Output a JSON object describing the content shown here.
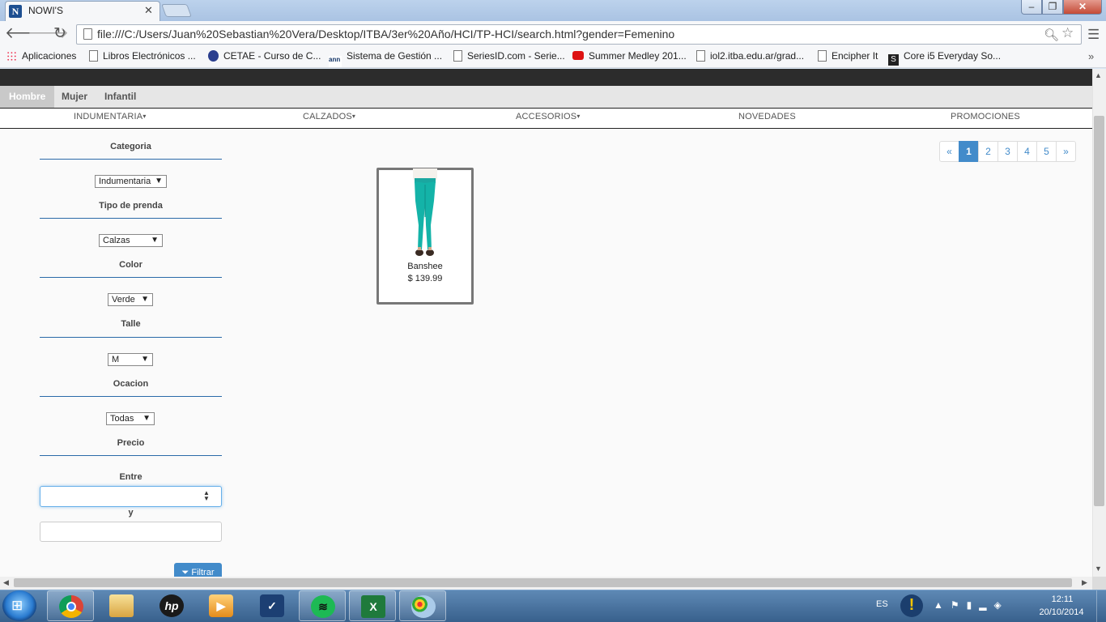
{
  "browser": {
    "tab_title": "NOWI'S",
    "favicon_letter": "N",
    "url": "file:///C:/Users/Juan%20Sebastian%20Vera/Desktop/ITBA/3er%20Año/HCI/TP-HCI/search.html?gender=Femenino",
    "window_buttons": {
      "minimize": "‒",
      "maximize": "❐",
      "close": "✕"
    },
    "bookmarks": [
      {
        "label": "Aplicaciones",
        "icon": "apps-icon"
      },
      {
        "label": "Libros Electrónicos ...",
        "icon": "page-icon"
      },
      {
        "label": "CETAE - Curso de C...",
        "icon": "cetae-icon"
      },
      {
        "label": "Sistema de Gestión ...",
        "icon": "sistema-icon"
      },
      {
        "label": "SeriesID.com - Serie...",
        "icon": "page-icon"
      },
      {
        "label": "Summer Medley 201...",
        "icon": "youtube-icon"
      },
      {
        "label": "iol2.itba.edu.ar/grad...",
        "icon": "page-icon"
      },
      {
        "label": "Encipher It",
        "icon": "page-icon"
      },
      {
        "label": "Core i5 Everyday So...",
        "icon": "site-s-icon"
      }
    ]
  },
  "site": {
    "gender_tabs": [
      "Hombre",
      "Mujer",
      "Infantil"
    ],
    "active_gender": "Hombre",
    "categories": [
      "INDUMENTARIA",
      "CALZADOS",
      "ACCESORIOS",
      "NOVEDADES",
      "PROMOCIONES"
    ],
    "filters": {
      "categoria": {
        "label": "Categoria",
        "value": "Indumentaria"
      },
      "tipo": {
        "label": "Tipo de prenda",
        "value": "Calzas"
      },
      "color": {
        "label": "Color",
        "value": "Verde"
      },
      "talle": {
        "label": "Talle",
        "value": "M"
      },
      "ocacion": {
        "label": "Ocacion",
        "value": "Todas"
      },
      "precio": {
        "label": "Precio",
        "between": "Entre",
        "and": "y",
        "from_value": "",
        "to_value": ""
      },
      "button": "Filtrar"
    },
    "pagination": {
      "prev": "«",
      "pages": [
        "1",
        "2",
        "3",
        "4",
        "5"
      ],
      "next": "»",
      "current": "1"
    },
    "products": [
      {
        "name": "Banshee",
        "price": "$ 139.99",
        "image": "teal-leggings"
      }
    ]
  },
  "taskbar": {
    "apps": [
      "start-icon",
      "chrome-icon",
      "explorer-icon",
      "hp-icon",
      "media-player-icon",
      "tick-icon",
      "spotify-icon",
      "excel-icon",
      "paint-icon"
    ],
    "language": "ES",
    "time": "12:11",
    "date": "20/10/2014"
  }
}
